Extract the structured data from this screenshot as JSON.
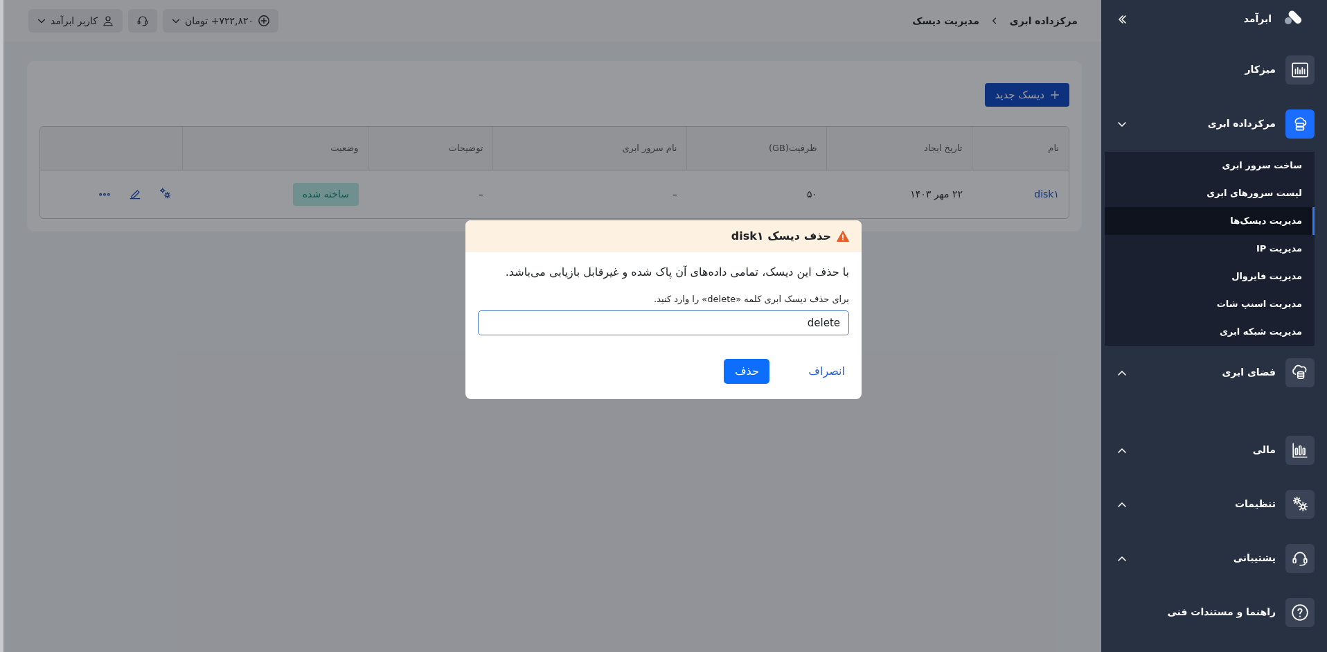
{
  "sidebar": {
    "brand": "ابرآمد",
    "items": [
      {
        "kind": "link",
        "label": "میزکار",
        "selected": false
      },
      {
        "kind": "group",
        "label": "مرکزداده ابری",
        "selected": true,
        "expanded": true,
        "children": [
          {
            "label": "ساخت سرور ابری",
            "selected": false
          },
          {
            "label": "لیست سرورهای ابری",
            "selected": false
          },
          {
            "label": "مدیریت دیسک‌ها",
            "selected": true
          },
          {
            "label": "مدیریت IP",
            "selected": false
          },
          {
            "label": "مدیریت فایروال",
            "selected": false
          },
          {
            "label": "مدیریت اسنپ شات",
            "selected": false
          },
          {
            "label": "مدیریت شبکه ابری",
            "selected": false
          }
        ]
      },
      {
        "kind": "group",
        "label": "فضای ابری",
        "selected": false,
        "expanded": false
      },
      {
        "kind": "group",
        "label": "مالی",
        "selected": false,
        "expanded": false
      },
      {
        "kind": "group",
        "label": "تنظیمات",
        "selected": false,
        "expanded": false
      },
      {
        "kind": "group",
        "label": "پشتیبانی",
        "selected": false,
        "expanded": false
      },
      {
        "kind": "link",
        "label": "راهنما و مستندات فنی",
        "selected": false
      }
    ]
  },
  "topbar": {
    "breadcrumb": [
      "مرکزداده ابری",
      "مدیریت دیسک"
    ],
    "balance": "۷۲۲,۸۲۰+ تومان",
    "user": "کاربر ابرآمد"
  },
  "new_button": "دیسک جدید",
  "table": {
    "columns": [
      "نام",
      "تاریخ ایجاد",
      "ظرفیت(GB)",
      "نام سرور ابری",
      "توضیحات",
      "وضعیت"
    ],
    "rows": [
      {
        "name": "disk۱",
        "created": "۲۲ مهر ۱۴۰۳",
        "capacity": "۵۰",
        "server": "–",
        "description": "–",
        "status": "ساخته شده"
      }
    ]
  },
  "dialog": {
    "title": "حذف دیسک disk۱",
    "message": "با حذف این دیسک، تمامی داده‌های آن پاک شده و غیرقابل بازیابی می‌باشد.",
    "prompt": "برای حذف دیسک ابری کلمه «delete» را وارد کنید.",
    "value": "delete",
    "confirm": "حذف",
    "cancel": "انصراف"
  }
}
